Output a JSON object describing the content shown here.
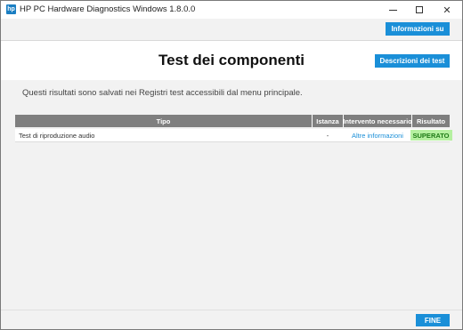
{
  "window": {
    "title": "HP PC Hardware Diagnostics Windows 1.8.0.0",
    "icon": "hp-logo",
    "icon_text": "hp",
    "controls": {
      "minimize": "minimize-icon",
      "maximize": "maximize-icon",
      "close": "✕"
    }
  },
  "header": {
    "info_button": "Informazioni su",
    "page_title": "Test dei componenti",
    "descriptions_button": "Descrizioni dei test"
  },
  "main": {
    "notice": "Questi risultati sono salvati nei Registri test accessibili dal menu principale.",
    "table": {
      "columns": [
        "Tipo",
        "Istanza",
        "Intervento necessario",
        "Risultato"
      ],
      "rows": [
        {
          "tipo": "Test di riproduzione audio",
          "istanza": "-",
          "intervento": "Altre informazioni",
          "risultato": "SUPERATO"
        }
      ]
    }
  },
  "footer": {
    "finish_button": "FINE"
  },
  "colors": {
    "accent": "#1a8fd8",
    "table_header": "#7f7f7f",
    "pass_bg": "#b5f0a0",
    "pass_text": "#1e7a16"
  }
}
